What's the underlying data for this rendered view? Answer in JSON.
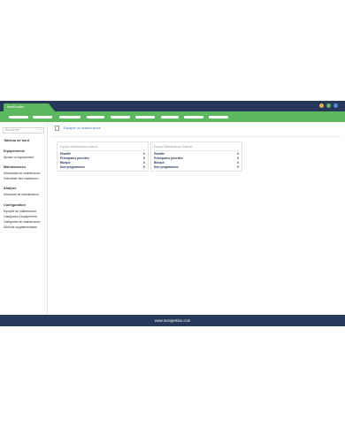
{
  "app": {
    "tab_label": "NextGestion",
    "window_dots": [
      "#e8b04a",
      "#5cb85c",
      "#4a90d9"
    ]
  },
  "sidebar": {
    "select_placeholder": "Recherche",
    "sections": [
      {
        "title": "Tableau de bord",
        "items": []
      },
      {
        "title": "Equipements",
        "items": [
          "Ajouter un équipement"
        ]
      },
      {
        "title": "Maintenances",
        "items": [
          "Demandes de maintenance",
          "Calendrier des maintenan..."
        ]
      },
      {
        "title": "Analyse",
        "items": [
          "Demande de maintenance"
        ]
      },
      {
        "title": "Configuration",
        "items": [
          "Equipes de maintenance",
          "Catégories d'équipement",
          "Catégories de maintenance",
          "Attributs supplémentaires"
        ]
      }
    ]
  },
  "main": {
    "breadcrumb": "Equipes de maintenance",
    "cards": [
      {
        "title": "Equipe Maintenance Interne",
        "rows": [
          {
            "label": "Planifié",
            "value": "0"
          },
          {
            "label": "Principales priorités",
            "value": "0"
          },
          {
            "label": "Bloqué",
            "value": "0"
          },
          {
            "label": "Non programmée",
            "value": "0"
          }
        ]
      },
      {
        "title": "Equipe Maintenance Externe",
        "rows": [
          {
            "label": "Planifié",
            "value": "0"
          },
          {
            "label": "Principales priorités",
            "value": "0"
          },
          {
            "label": "Bloqué",
            "value": "0"
          },
          {
            "label": "Non programmée",
            "value": "0"
          }
        ]
      }
    ]
  },
  "footer": {
    "text": "www.nextgestion.com"
  },
  "colors": {
    "header": "#27395a",
    "accent": "#5cb85c",
    "link": "#4a7ab5"
  }
}
